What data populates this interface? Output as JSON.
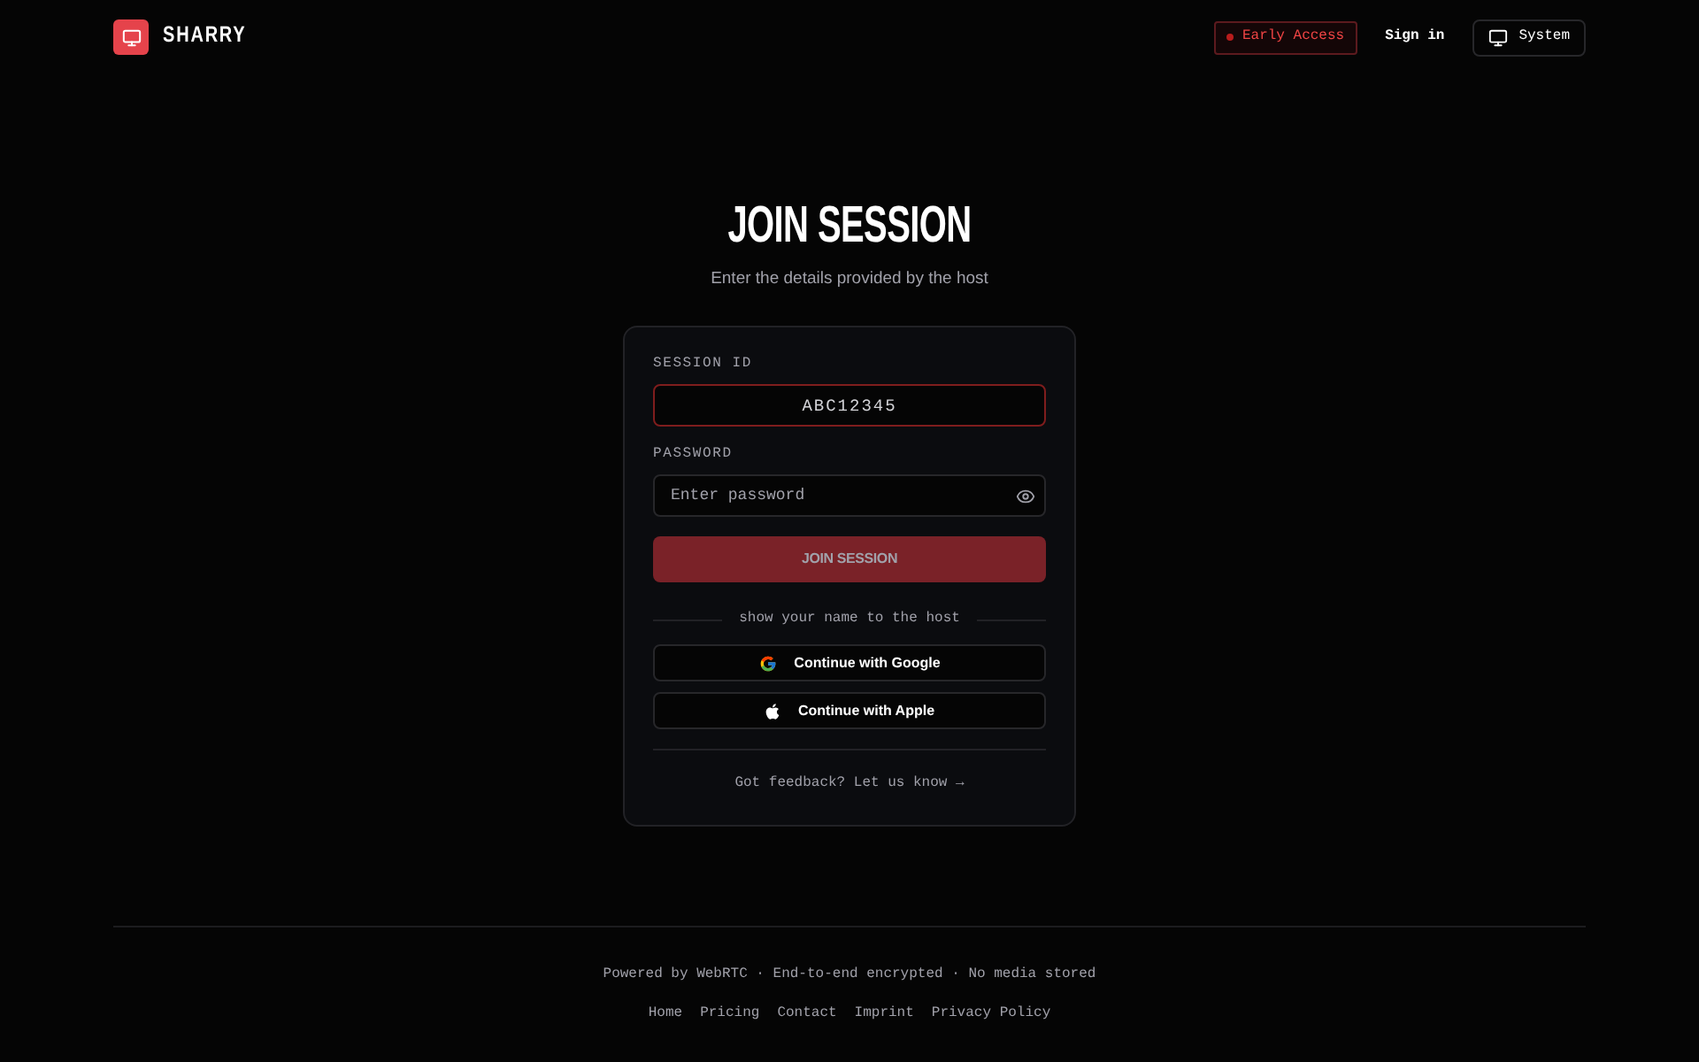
{
  "header": {
    "logo": {
      "name": "SHARRY"
    },
    "badge": "Early Access",
    "sign_in": "Sign in",
    "theme_button": "System"
  },
  "main": {
    "title": "JOIN SESSION",
    "subtitle": "Enter the details provided by the host"
  },
  "form": {
    "fields": [
      {
        "kind": "code",
        "label": "SESSION ID",
        "value": "ABC12345",
        "focused": true
      },
      {
        "kind": "password",
        "label": "PASSWORD",
        "placeholder": "Enter password",
        "focused": false
      }
    ],
    "submit": {
      "label": "JOIN SESSION",
      "disabled": true
    },
    "divider_text": "show your name to the host",
    "providers": [
      {
        "kind": "google",
        "label": "Continue with Google"
      },
      {
        "kind": "apple",
        "label": "Continue with Apple"
      }
    ],
    "feedback_link": "Got feedback? Let us know →"
  },
  "footer": {
    "tagline": "Powered by WebRTC · End-to-end encrypted · No media stored",
    "links": [
      "Home",
      "Pricing",
      "Contact",
      "Imprint",
      "Privacy Policy"
    ]
  }
}
